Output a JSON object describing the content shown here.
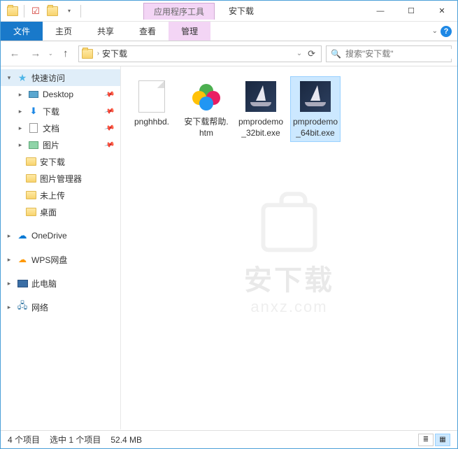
{
  "titlebar": {
    "contextual_tab": "应用程序工具",
    "window_title": "安下载"
  },
  "window_controls": {
    "min": "—",
    "max": "☐",
    "close": "✕"
  },
  "ribbon": {
    "file": "文件",
    "home": "主页",
    "share": "共享",
    "view": "查看",
    "manage": "管理"
  },
  "nav": {
    "back": "←",
    "forward": "→",
    "up": "↑",
    "path_sep": "›",
    "location": "安下载",
    "addr_dropdown": "⌄",
    "refresh": "⟳"
  },
  "search": {
    "placeholder": "搜索\"安下载\""
  },
  "sidebar": {
    "quick_access": "快速访问",
    "items": [
      {
        "label": "Desktop",
        "pinned": true
      },
      {
        "label": "下载",
        "pinned": true
      },
      {
        "label": "文档",
        "pinned": true
      },
      {
        "label": "图片",
        "pinned": true
      },
      {
        "label": "安下载",
        "pinned": false
      },
      {
        "label": "图片管理器",
        "pinned": false
      },
      {
        "label": "未上传",
        "pinned": false
      },
      {
        "label": "桌面",
        "pinned": false
      }
    ],
    "onedrive": "OneDrive",
    "wps": "WPS网盘",
    "thispc": "此电脑",
    "network": "网络"
  },
  "files": [
    {
      "name": "pnghhbd.",
      "type": "blank",
      "selected": false
    },
    {
      "name": "安下载帮助.htm",
      "type": "htm",
      "selected": false
    },
    {
      "name": "pmprodemo_32bit.exe",
      "type": "exe",
      "selected": false
    },
    {
      "name": "pmprodemo_64bit.exe",
      "type": "exe",
      "selected": true
    }
  ],
  "watermark": {
    "line1": "安下载",
    "line2": "anxz.com"
  },
  "status": {
    "count": "4 个项目",
    "selection": "选中 1 个项目",
    "size": "52.4 MB"
  }
}
